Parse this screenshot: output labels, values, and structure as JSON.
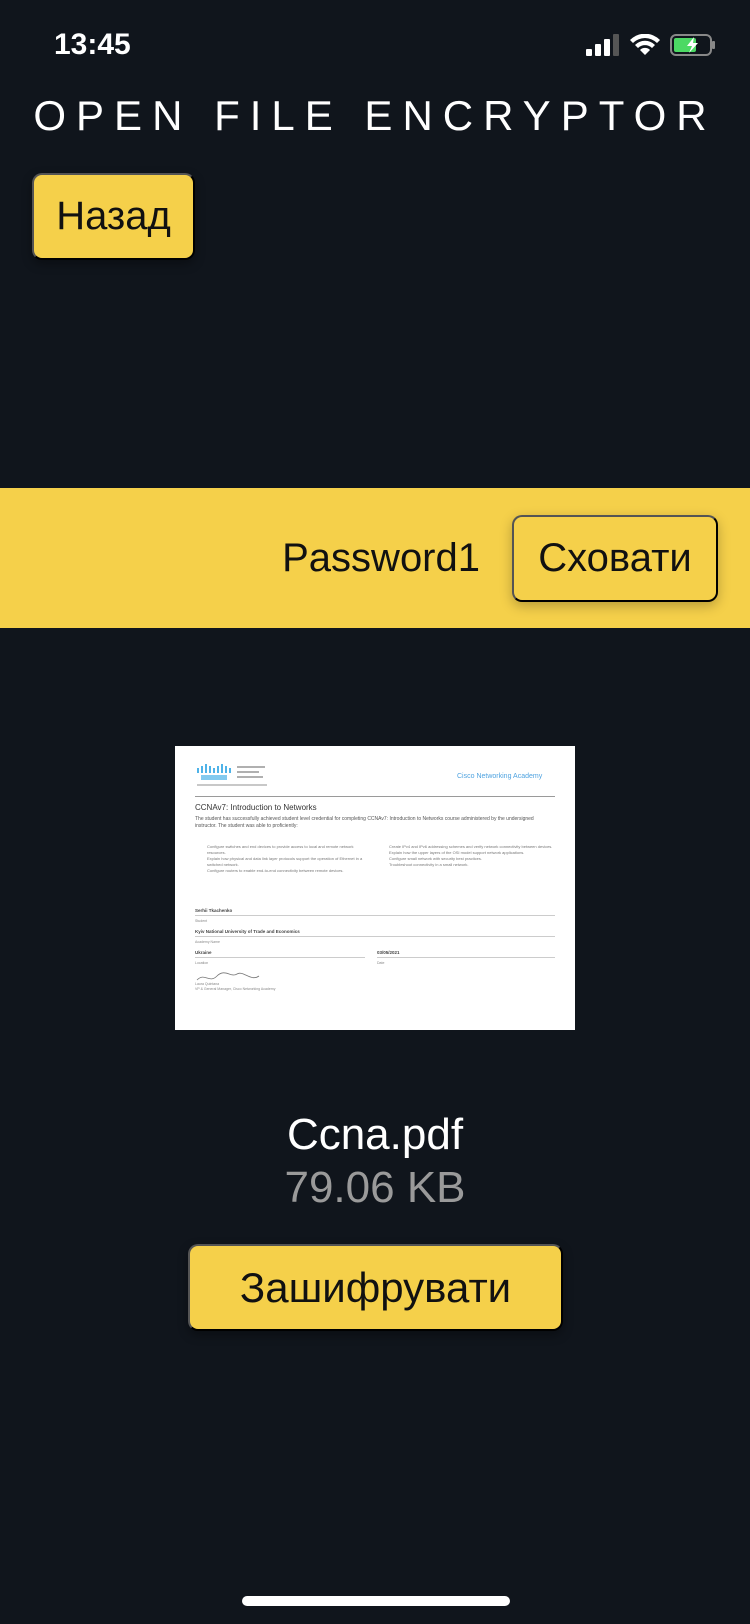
{
  "status_bar": {
    "time": "13:45"
  },
  "app": {
    "title": "OPEN FILE ENCRYPTOR"
  },
  "nav": {
    "back_label": "Назад"
  },
  "password": {
    "value": "Password1",
    "hide_label": "Сховати"
  },
  "preview": {
    "org": "Cisco Networking Academy",
    "heading": "CCNAv7: Introduction to Networks",
    "intro": "The student has successfully achieved student level credential for completing CCNAv7: Introduction to Networks course administered by the undersigned instructor. The student was able to proficiently:",
    "bullets_left": [
      "Configure switches and end devices to provide access to local and remote network resources.",
      "Explain how physical and data link layer protocols support the operation of Ethernet in a switched network.",
      "Configure routers to enable end-to-end connectivity between remote devices."
    ],
    "bullets_right": [
      "Create IPv4 and IPv6 addressing schemes and verify network connectivity between devices.",
      "Explain how the upper layers of the OSI model support network applications.",
      "Configure small network with security best practices.",
      "Troubleshoot connectivity in a small network."
    ],
    "student": "Serhii Tkachenko",
    "student_caption": "Student",
    "academy": "Kyiv National University of Trade and Economics",
    "academy_caption": "Academy Name",
    "location": "Ukraine",
    "location_caption": "Location",
    "date": "03/05/2021",
    "date_caption": "Date",
    "signature_caption": "Laura Quintana\nVP & General Manager, Cisco Networking Academy"
  },
  "file": {
    "name": "Ccna.pdf",
    "size": "79.06 KB"
  },
  "actions": {
    "encrypt_label": "Зашифрувати"
  },
  "colors": {
    "background": "#10151c",
    "accent": "#f5d04a",
    "muted_text": "#9a9a9a"
  }
}
